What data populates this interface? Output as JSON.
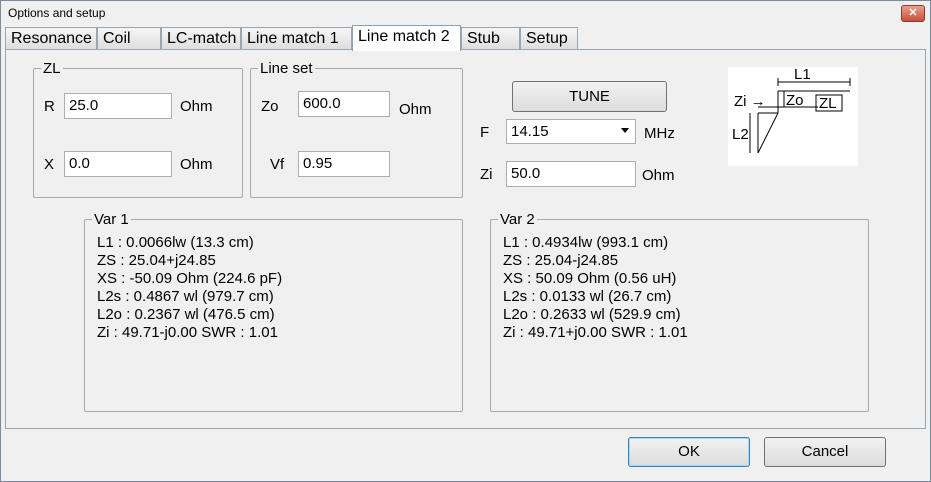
{
  "window": {
    "title": "Options and setup",
    "close_glyph": "✕"
  },
  "tabs": [
    {
      "label": "Resonance"
    },
    {
      "label": "Coil"
    },
    {
      "label": "LC-match"
    },
    {
      "label": "Line match  1"
    },
    {
      "label": "Line match 2"
    },
    {
      "label": "Stub"
    },
    {
      "label": "Setup"
    }
  ],
  "zl": {
    "title": "ZL",
    "r_label": "R",
    "r_value": "25.0",
    "r_unit": "Ohm",
    "x_label": "X",
    "x_value": "0.0",
    "x_unit": "Ohm"
  },
  "line_set": {
    "title": "Line set",
    "zo_label": "Zo",
    "zo_value": "600.0",
    "zo_unit": "Ohm",
    "vf_label": "Vf",
    "vf_value": "0.95"
  },
  "tune": {
    "label": "TUNE"
  },
  "freq": {
    "label": "F",
    "value": "14.15",
    "unit": "MHz"
  },
  "zi": {
    "label": "Zi",
    "value": "50.0",
    "unit": "Ohm"
  },
  "diagram": {
    "l1": "L1",
    "zi": "Zi →",
    "zo": "Zo",
    "zl": "ZL",
    "l2": "L2"
  },
  "var1": {
    "title": "Var 1",
    "lines": [
      "L1 : 0.0066lw (13.3 cm)",
      "ZS : 25.04+j24.85",
      "XS : -50.09 Ohm (224.6 pF)",
      "L2s : 0.4867 wl (979.7 cm)",
      "L2o : 0.2367 wl (476.5 cm)",
      "Zi : 49.71-j0.00 SWR : 1.01"
    ]
  },
  "var2": {
    "title": "Var 2",
    "lines": [
      "L1 : 0.4934lw (993.1 cm)",
      "ZS : 25.04-j24.85",
      "XS : 50.09 Ohm (0.56 uH)",
      "L2s : 0.0133 wl (26.7 cm)",
      "L2o : 0.2633 wl (529.9 cm)",
      "Zi : 49.71+j0.00 SWR : 1.01"
    ]
  },
  "footer": {
    "ok_label": "OK",
    "cancel_label": "Cancel"
  }
}
